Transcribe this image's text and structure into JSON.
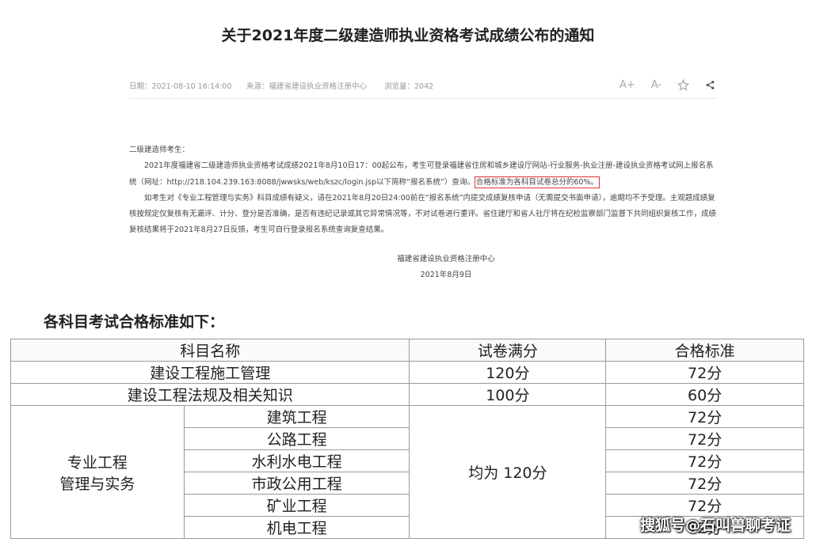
{
  "article": {
    "title": "关于2021年度二级建造师执业资格考试成绩公布的通知",
    "meta": {
      "date": "日期：2021-08-10 16:14:00",
      "source": "来源：福建省建设执业资格注册中心",
      "views": "浏览量：2042"
    },
    "tools": {
      "font_increase": "A+",
      "font_decrease": "A-"
    },
    "greeting": "二级建造师考生：",
    "para1_a": "2021年度福建省二级建造师执业资格考试成绩2021年8月10日17：00起公布，考生可登录福建省住房和城乡建设厅网站-行业服务-执业注册-建设执业资格考试网上报名系统（网址：http://218.104.239.163:8088/jwwsks/web/kszc/login.jsp以下简称“报名系统”）查询。",
    "para1_highlight": "合格标准为各科目试卷总分的60%。",
    "para2": "如考生对《专业工程管理与实务》科目成绩有疑义，请在2021年8月20日24:00前在“报名系统”内提交成绩复核申请（无需提交书面申请），逾期均不予受理。主观题成绩复核按规定仅复核有无漏评、计分、登分是否准确，是否有违纪记录或其它异常情况等，不对试卷进行重评。省住建厅和省人社厅将在纪检监察部门监督下共同组织复核工作，成绩复核结果将于2021年8月27日反馈，考生可自行登录报名系统查询复查结果。",
    "sign_org": "福建省建设执业资格注册中心",
    "sign_date": "2021年8月9日"
  },
  "standards": {
    "heading": "各科目考试合格标准如下：",
    "columns": [
      "科目名称",
      "试卷满分",
      "合格标准"
    ],
    "rows": [
      {
        "subject": "建设工程施工管理",
        "full": "120分",
        "pass": "72分"
      },
      {
        "subject": "建设工程法规及相关知识",
        "full": "100分",
        "pass": "60分"
      }
    ],
    "practice": {
      "group_line1": "专业工程",
      "group_line2": "管理与实务",
      "full_all": "均为 120分",
      "items": [
        {
          "name": "建筑工程",
          "pass": "72分"
        },
        {
          "name": "公路工程",
          "pass": "72分"
        },
        {
          "name": "水利水电工程",
          "pass": "72分"
        },
        {
          "name": "市政公用工程",
          "pass": "72分"
        },
        {
          "name": "矿业工程",
          "pass": "72分"
        },
        {
          "name": "机电工程",
          "pass": "72分"
        }
      ]
    }
  },
  "watermark": "搜狐号@石叫兽聊考证",
  "colors": {
    "highlight_border": "#e03131",
    "grid": "#999999"
  },
  "icons": [
    "star-icon",
    "share-icon"
  ]
}
